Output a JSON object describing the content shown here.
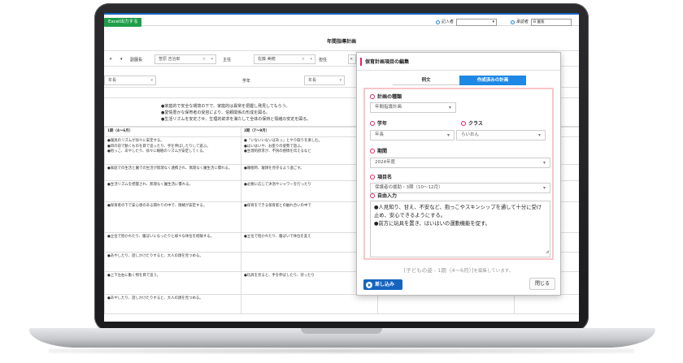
{
  "toolbar": {
    "excel_button": "Excel出力する",
    "author_label": "記入者",
    "approver_label": "承認者",
    "approver_value": "B 園長"
  },
  "page": {
    "title": "年間指導計画"
  },
  "filters": {
    "vice_principal_label": "副園長",
    "vice_principal_value": "笹原 吉治郎",
    "chief_label": "主任",
    "chief_value": "佐藤 美穂",
    "other_label": "担任"
  },
  "grade_row": {
    "left_value": "年長",
    "grade_label": "学年",
    "grade_value": "年長"
  },
  "aims": [
    "●家庭的で安全な環境の下で、家庭的は異常を把握し発見してもらう。",
    "●愛情豊かな保育者の受容により、信頼関係の形成を図る。",
    "●生活リズムを安定させ、生理的欲求を満たして全体の保持と情緒の安定を図る。"
  ],
  "table": {
    "headers": [
      "1期（4〜6月）",
      "2期（7〜9月）"
    ],
    "rows": [
      [
        "●寝具のリズムが徐々に安定する。",
        "●「いないいないばあっ」とやり取りを楽しむ。"
      ],
      [
        "●目の前で動くものを目で追ったり、手を伸ばしたりして遊ぶ。",
        "●はいはいや、お座りの姿勢で遊ぶ。"
      ],
      [
        "●抱っこ、あやしたり、徐々に睡眠のリズムが安定してくる。",
        "●生理的欲求が、不快の感情を伝えるなど"
      ],
      [
        "●家庭での生活と園での生活が無理なく連携され、無理なく園生活に慣れる。",
        "●睡眠時、寝顔を見守るよう過ごす。"
      ],
      [
        "●生活リズムを把握され、無理なく園生活に慣れる。",
        "●必要に応じて沐浴やシャワーを行ったり"
      ],
      [
        "●保育者の下で安心感のある関わりの中で、情緒が安定する。",
        "●保育をできる保育者との触れ合いの中で"
      ],
      [
        "●立位で抱かれたり、腹ばいになったりと様々な体位を経験する。",
        "●立位で抱かれたり、腹ばいで体位を変え"
      ],
      [
        "●あやしたり、話しかけたりすると、大人の顔を見つめる。",
        ""
      ],
      [
        "●上下左右に動く物を目で追う。",
        "●玩具を見ると、手を伸ばしたり、持ったり"
      ],
      [
        "●あやしたり、話しかけたりすると、大人の顔を見つめる。",
        ""
      ]
    ]
  },
  "modal": {
    "title": "保育計画項目の編集",
    "tab_example": "例文",
    "tab_created": "作成済みの計画",
    "plan_type_label": "計画の種類",
    "plan_type_value": "年間指導計画",
    "grade_label": "学年",
    "grade_value": "年長",
    "class_label": "クラス",
    "class_value": "らいおん",
    "period_label": "期間",
    "period_value": "2024年度",
    "item_label": "項目名",
    "item_value": "保護者の援助・3期（10〜12月）",
    "free_label": "自由入力",
    "free_lines": [
      "●人見知り、甘え、不安など、抱っこやスキンシップを通して十分に受け止め、安心できるようにする。",
      "●前方に玩具を置き、はいはいの運動機能を促す。"
    ],
    "editing_note_prefix": "[子どもの姿 - 1期（4〜6月）]",
    "editing_note_suffix": "を編集しています。",
    "insert_button": "差し込み",
    "close_button": "閉じる"
  }
}
